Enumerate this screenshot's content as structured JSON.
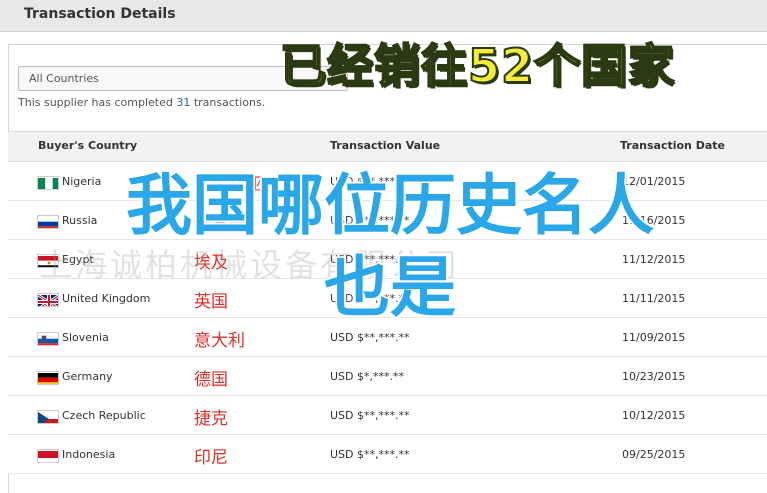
{
  "header": {
    "title": "Transaction Details"
  },
  "filter": {
    "selected": "All Countries"
  },
  "summary": {
    "prefix": "This supplier has completed ",
    "count": "31",
    "suffix": " transactions."
  },
  "table": {
    "columns": [
      "Buyer's Country",
      "Transaction Value",
      "Transaction Date"
    ],
    "rows": [
      {
        "country": "Nigeria",
        "value": "USD $**,***.**",
        "date": "12/01/2015",
        "cn": "尼日利亚",
        "flag": "nigeria-flag-icon"
      },
      {
        "country": "Russia",
        "value": "USD $**,***.**",
        "date": "11/16/2015",
        "cn": "俄罗斯",
        "flag": "russia-flag-icon"
      },
      {
        "country": "Egypt",
        "value": "USD $**,***.**",
        "date": "11/12/2015",
        "cn": "埃及",
        "flag": "egypt-flag-icon"
      },
      {
        "country": "United Kingdom",
        "value": "USD $**,***.**",
        "date": "11/11/2015",
        "cn": "英国",
        "flag": "uk-flag-icon"
      },
      {
        "country": "Slovenia",
        "value": "USD $**,***.**",
        "date": "11/09/2015",
        "cn": "意大利",
        "flag": "slovenia-flag-icon"
      },
      {
        "country": "Germany",
        "value": "USD $*,***.**",
        "date": "10/23/2015",
        "cn": "德国",
        "flag": "germany-flag-icon"
      },
      {
        "country": "Czech Republic",
        "value": "USD $**,***.**",
        "date": "10/12/2015",
        "cn": "捷克",
        "flag": "czech-flag-icon"
      },
      {
        "country": "Indonesia",
        "value": "USD $**,***.**",
        "date": "09/25/2015",
        "cn": "印尼",
        "flag": "indonesia-flag-icon"
      }
    ]
  },
  "overlay": {
    "top_text": "已经销往52个国家",
    "main_line1": "我国哪位历史名人",
    "main_line2": "也是"
  },
  "watermark": "上海诚柏机械设备有限公司",
  "colors": {
    "overlay_yellow": "#f3ec3a",
    "overlay_blue": "#2aa7e8",
    "cn_red": "#e0302a",
    "link_blue": "#1f5fa8"
  }
}
